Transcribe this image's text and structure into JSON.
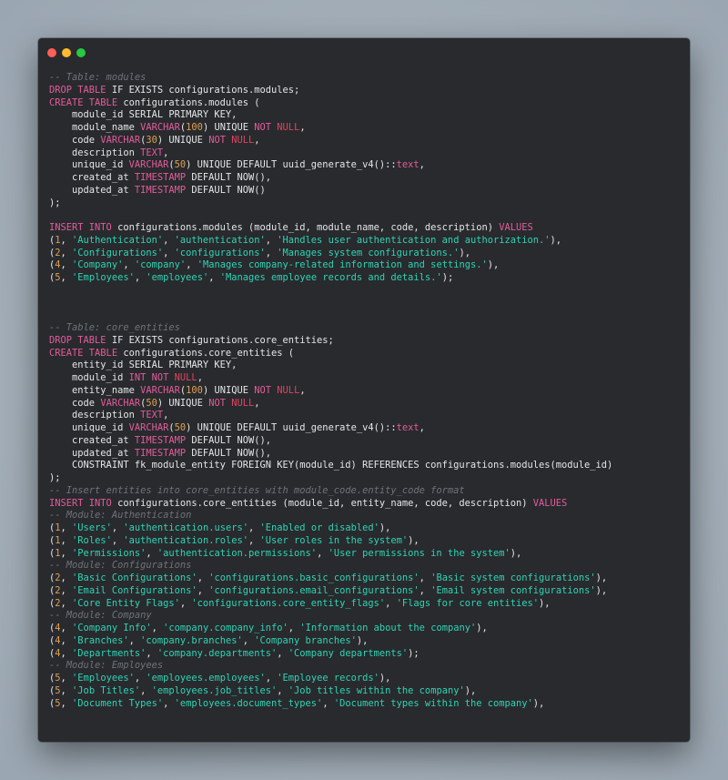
{
  "window": {
    "controls": [
      {
        "name": "close",
        "color": "#ff5f57"
      },
      {
        "name": "minimize",
        "color": "#febc2e"
      },
      {
        "name": "maximize",
        "color": "#28c840"
      }
    ]
  },
  "colors": {
    "background": "#a3aeb8",
    "editor": "#282a2e",
    "comment": "#6f7377",
    "keyword": "#e55b9b",
    "null": "#e0445f",
    "number": "#e0a050",
    "string": "#2fd4b4",
    "text": "#e6e6e6"
  },
  "code_lines": [
    [
      [
        "cm",
        "-- Table: modules"
      ]
    ],
    [
      [
        "kw",
        "DROP TABLE"
      ],
      [
        "pl",
        " IF EXISTS configurations.modules;"
      ]
    ],
    [
      [
        "kw",
        "CREATE TABLE"
      ],
      [
        "pl",
        " configurations.modules ("
      ]
    ],
    [
      [
        "pl",
        "    module_id SERIAL PRIMARY KEY,"
      ]
    ],
    [
      [
        "pl",
        "    module_name "
      ],
      [
        "kw",
        "VARCHAR"
      ],
      [
        "pl",
        "("
      ],
      [
        "num",
        "100"
      ],
      [
        "pl",
        ") UNIQUE "
      ],
      [
        "kw",
        "NOT"
      ],
      [
        "pl",
        " "
      ],
      [
        "nl",
        "NULL"
      ],
      [
        "pl",
        ","
      ]
    ],
    [
      [
        "pl",
        "    code "
      ],
      [
        "kw",
        "VARCHAR"
      ],
      [
        "pl",
        "("
      ],
      [
        "num",
        "30"
      ],
      [
        "pl",
        ") UNIQUE "
      ],
      [
        "kw",
        "NOT"
      ],
      [
        "pl",
        " "
      ],
      [
        "nl",
        "NULL"
      ],
      [
        "pl",
        ","
      ]
    ],
    [
      [
        "pl",
        "    description "
      ],
      [
        "kw",
        "TEXT"
      ],
      [
        "pl",
        ","
      ]
    ],
    [
      [
        "pl",
        "    unique_id "
      ],
      [
        "kw",
        "VARCHAR"
      ],
      [
        "pl",
        "("
      ],
      [
        "num",
        "50"
      ],
      [
        "pl",
        ") UNIQUE DEFAULT uuid_generate_v4()::"
      ],
      [
        "kw",
        "text"
      ],
      [
        "pl",
        ","
      ]
    ],
    [
      [
        "pl",
        "    created_at "
      ],
      [
        "kw",
        "TIMESTAMP"
      ],
      [
        "pl",
        " DEFAULT NOW(),"
      ]
    ],
    [
      [
        "pl",
        "    updated_at "
      ],
      [
        "kw",
        "TIMESTAMP"
      ],
      [
        "pl",
        " DEFAULT NOW()"
      ]
    ],
    [
      [
        "pl",
        ");"
      ]
    ],
    [
      [
        "pl",
        ""
      ]
    ],
    [
      [
        "kw",
        "INSERT INTO"
      ],
      [
        "pl",
        " configurations.modules (module_id, module_name, code, description) "
      ],
      [
        "kw",
        "VALUES"
      ]
    ],
    [
      [
        "pl",
        "("
      ],
      [
        "num",
        "1"
      ],
      [
        "pl",
        ", "
      ],
      [
        "str",
        "'Authentication'"
      ],
      [
        "pl",
        ", "
      ],
      [
        "str",
        "'authentication'"
      ],
      [
        "pl",
        ", "
      ],
      [
        "str",
        "'Handles user authentication and authorization.'"
      ],
      [
        "pl",
        "),"
      ]
    ],
    [
      [
        "pl",
        "("
      ],
      [
        "num",
        "2"
      ],
      [
        "pl",
        ", "
      ],
      [
        "str",
        "'Configurations'"
      ],
      [
        "pl",
        ", "
      ],
      [
        "str",
        "'configurations'"
      ],
      [
        "pl",
        ", "
      ],
      [
        "str",
        "'Manages system configurations.'"
      ],
      [
        "pl",
        "),"
      ]
    ],
    [
      [
        "pl",
        "("
      ],
      [
        "num",
        "4"
      ],
      [
        "pl",
        ", "
      ],
      [
        "str",
        "'Company'"
      ],
      [
        "pl",
        ", "
      ],
      [
        "str",
        "'company'"
      ],
      [
        "pl",
        ", "
      ],
      [
        "str",
        "'Manages company-related information and settings.'"
      ],
      [
        "pl",
        "),"
      ]
    ],
    [
      [
        "pl",
        "("
      ],
      [
        "num",
        "5"
      ],
      [
        "pl",
        ", "
      ],
      [
        "str",
        "'Employees'"
      ],
      [
        "pl",
        ", "
      ],
      [
        "str",
        "'employees'"
      ],
      [
        "pl",
        ", "
      ],
      [
        "str",
        "'Manages employee records and details.'"
      ],
      [
        "pl",
        ");"
      ]
    ],
    [
      [
        "pl",
        ""
      ]
    ],
    [
      [
        "pl",
        ""
      ]
    ],
    [
      [
        "pl",
        ""
      ]
    ],
    [
      [
        "cm",
        "-- Table: core_entities"
      ]
    ],
    [
      [
        "kw",
        "DROP TABLE"
      ],
      [
        "pl",
        " IF EXISTS configurations.core_entities;"
      ]
    ],
    [
      [
        "kw",
        "CREATE TABLE"
      ],
      [
        "pl",
        " configurations.core_entities ("
      ]
    ],
    [
      [
        "pl",
        "    entity_id SERIAL PRIMARY KEY,"
      ]
    ],
    [
      [
        "pl",
        "    module_id "
      ],
      [
        "kw",
        "INT NOT"
      ],
      [
        "pl",
        " "
      ],
      [
        "nl",
        "NULL"
      ],
      [
        "pl",
        ","
      ]
    ],
    [
      [
        "pl",
        "    entity_name "
      ],
      [
        "kw",
        "VARCHAR"
      ],
      [
        "pl",
        "("
      ],
      [
        "num",
        "100"
      ],
      [
        "pl",
        ") UNIQUE "
      ],
      [
        "kw",
        "NOT"
      ],
      [
        "pl",
        " "
      ],
      [
        "nl",
        "NULL"
      ],
      [
        "pl",
        ","
      ]
    ],
    [
      [
        "pl",
        "    code "
      ],
      [
        "kw",
        "VARCHAR"
      ],
      [
        "pl",
        "("
      ],
      [
        "num",
        "50"
      ],
      [
        "pl",
        ") UNIQUE "
      ],
      [
        "kw",
        "NOT"
      ],
      [
        "pl",
        " "
      ],
      [
        "nl",
        "NULL"
      ],
      [
        "pl",
        ","
      ]
    ],
    [
      [
        "pl",
        "    description "
      ],
      [
        "kw",
        "TEXT"
      ],
      [
        "pl",
        ","
      ]
    ],
    [
      [
        "pl",
        "    unique_id "
      ],
      [
        "kw",
        "VARCHAR"
      ],
      [
        "pl",
        "("
      ],
      [
        "num",
        "50"
      ],
      [
        "pl",
        ") UNIQUE DEFAULT uuid_generate_v4()::"
      ],
      [
        "kw",
        "text"
      ],
      [
        "pl",
        ","
      ]
    ],
    [
      [
        "pl",
        "    created_at "
      ],
      [
        "kw",
        "TIMESTAMP"
      ],
      [
        "pl",
        " DEFAULT NOW(),"
      ]
    ],
    [
      [
        "pl",
        "    updated_at "
      ],
      [
        "kw",
        "TIMESTAMP"
      ],
      [
        "pl",
        " DEFAULT NOW(),"
      ]
    ],
    [
      [
        "pl",
        "    CONSTRAINT fk_module_entity FOREIGN KEY(module_id) REFERENCES configurations.modules(module_id)"
      ]
    ],
    [
      [
        "pl",
        ");"
      ]
    ],
    [
      [
        "cm",
        "-- Insert entities into core_entities with module_code.entity_code format"
      ]
    ],
    [
      [
        "kw",
        "INSERT INTO"
      ],
      [
        "pl",
        " configurations.core_entities (module_id, entity_name, code, description) "
      ],
      [
        "kw",
        "VALUES"
      ]
    ],
    [
      [
        "cm",
        "-- Module: Authentication"
      ]
    ],
    [
      [
        "pl",
        "("
      ],
      [
        "num",
        "1"
      ],
      [
        "pl",
        ", "
      ],
      [
        "str",
        "'Users'"
      ],
      [
        "pl",
        ", "
      ],
      [
        "str",
        "'authentication.users'"
      ],
      [
        "pl",
        ", "
      ],
      [
        "str",
        "'Enabled or disabled'"
      ],
      [
        "pl",
        "),"
      ]
    ],
    [
      [
        "pl",
        "("
      ],
      [
        "num",
        "1"
      ],
      [
        "pl",
        ", "
      ],
      [
        "str",
        "'Roles'"
      ],
      [
        "pl",
        ", "
      ],
      [
        "str",
        "'authentication.roles'"
      ],
      [
        "pl",
        ", "
      ],
      [
        "str",
        "'User roles in the system'"
      ],
      [
        "pl",
        "),"
      ]
    ],
    [
      [
        "pl",
        "("
      ],
      [
        "num",
        "1"
      ],
      [
        "pl",
        ", "
      ],
      [
        "str",
        "'Permissions'"
      ],
      [
        "pl",
        ", "
      ],
      [
        "str",
        "'authentication.permissions'"
      ],
      [
        "pl",
        ", "
      ],
      [
        "str",
        "'User permissions in the system'"
      ],
      [
        "pl",
        "),"
      ]
    ],
    [
      [
        "cm",
        "-- Module: Configurations"
      ]
    ],
    [
      [
        "pl",
        "("
      ],
      [
        "num",
        "2"
      ],
      [
        "pl",
        ", "
      ],
      [
        "str",
        "'Basic Configurations'"
      ],
      [
        "pl",
        ", "
      ],
      [
        "str",
        "'configurations.basic_configurations'"
      ],
      [
        "pl",
        ", "
      ],
      [
        "str",
        "'Basic system configurations'"
      ],
      [
        "pl",
        "),"
      ]
    ],
    [
      [
        "pl",
        "("
      ],
      [
        "num",
        "2"
      ],
      [
        "pl",
        ", "
      ],
      [
        "str",
        "'Email Configurations'"
      ],
      [
        "pl",
        ", "
      ],
      [
        "str",
        "'configurations.email_configurations'"
      ],
      [
        "pl",
        ", "
      ],
      [
        "str",
        "'Email system configurations'"
      ],
      [
        "pl",
        "),"
      ]
    ],
    [
      [
        "pl",
        "("
      ],
      [
        "num",
        "2"
      ],
      [
        "pl",
        ", "
      ],
      [
        "str",
        "'Core Entity Flags'"
      ],
      [
        "pl",
        ", "
      ],
      [
        "str",
        "'configurations.core_entity_flags'"
      ],
      [
        "pl",
        ", "
      ],
      [
        "str",
        "'Flags for core entities'"
      ],
      [
        "pl",
        "),"
      ]
    ],
    [
      [
        "cm",
        "-- Module: Company"
      ]
    ],
    [
      [
        "pl",
        "("
      ],
      [
        "num",
        "4"
      ],
      [
        "pl",
        ", "
      ],
      [
        "str",
        "'Company Info'"
      ],
      [
        "pl",
        ", "
      ],
      [
        "str",
        "'company.company_info'"
      ],
      [
        "pl",
        ", "
      ],
      [
        "str",
        "'Information about the company'"
      ],
      [
        "pl",
        "),"
      ]
    ],
    [
      [
        "pl",
        "("
      ],
      [
        "num",
        "4"
      ],
      [
        "pl",
        ", "
      ],
      [
        "str",
        "'Branches'"
      ],
      [
        "pl",
        ", "
      ],
      [
        "str",
        "'company.branches'"
      ],
      [
        "pl",
        ", "
      ],
      [
        "str",
        "'Company branches'"
      ],
      [
        "pl",
        "),"
      ]
    ],
    [
      [
        "pl",
        "("
      ],
      [
        "num",
        "4"
      ],
      [
        "pl",
        ", "
      ],
      [
        "str",
        "'Departments'"
      ],
      [
        "pl",
        ", "
      ],
      [
        "str",
        "'company.departments'"
      ],
      [
        "pl",
        ", "
      ],
      [
        "str",
        "'Company departments'"
      ],
      [
        "pl",
        ");"
      ]
    ],
    [
      [
        "cm",
        "-- Module: Employees"
      ]
    ],
    [
      [
        "pl",
        "("
      ],
      [
        "num",
        "5"
      ],
      [
        "pl",
        ", "
      ],
      [
        "str",
        "'Employees'"
      ],
      [
        "pl",
        ", "
      ],
      [
        "str",
        "'employees.employees'"
      ],
      [
        "pl",
        ", "
      ],
      [
        "str",
        "'Employee records'"
      ],
      [
        "pl",
        "),"
      ]
    ],
    [
      [
        "pl",
        "("
      ],
      [
        "num",
        "5"
      ],
      [
        "pl",
        ", "
      ],
      [
        "str",
        "'Job Titles'"
      ],
      [
        "pl",
        ", "
      ],
      [
        "str",
        "'employees.job_titles'"
      ],
      [
        "pl",
        ", "
      ],
      [
        "str",
        "'Job titles within the company'"
      ],
      [
        "pl",
        "),"
      ]
    ],
    [
      [
        "pl",
        "("
      ],
      [
        "num",
        "5"
      ],
      [
        "pl",
        ", "
      ],
      [
        "str",
        "'Document Types'"
      ],
      [
        "pl",
        ", "
      ],
      [
        "str",
        "'employees.document_types'"
      ],
      [
        "pl",
        ", "
      ],
      [
        "str",
        "'Document types within the company'"
      ],
      [
        "pl",
        "),"
      ]
    ]
  ]
}
